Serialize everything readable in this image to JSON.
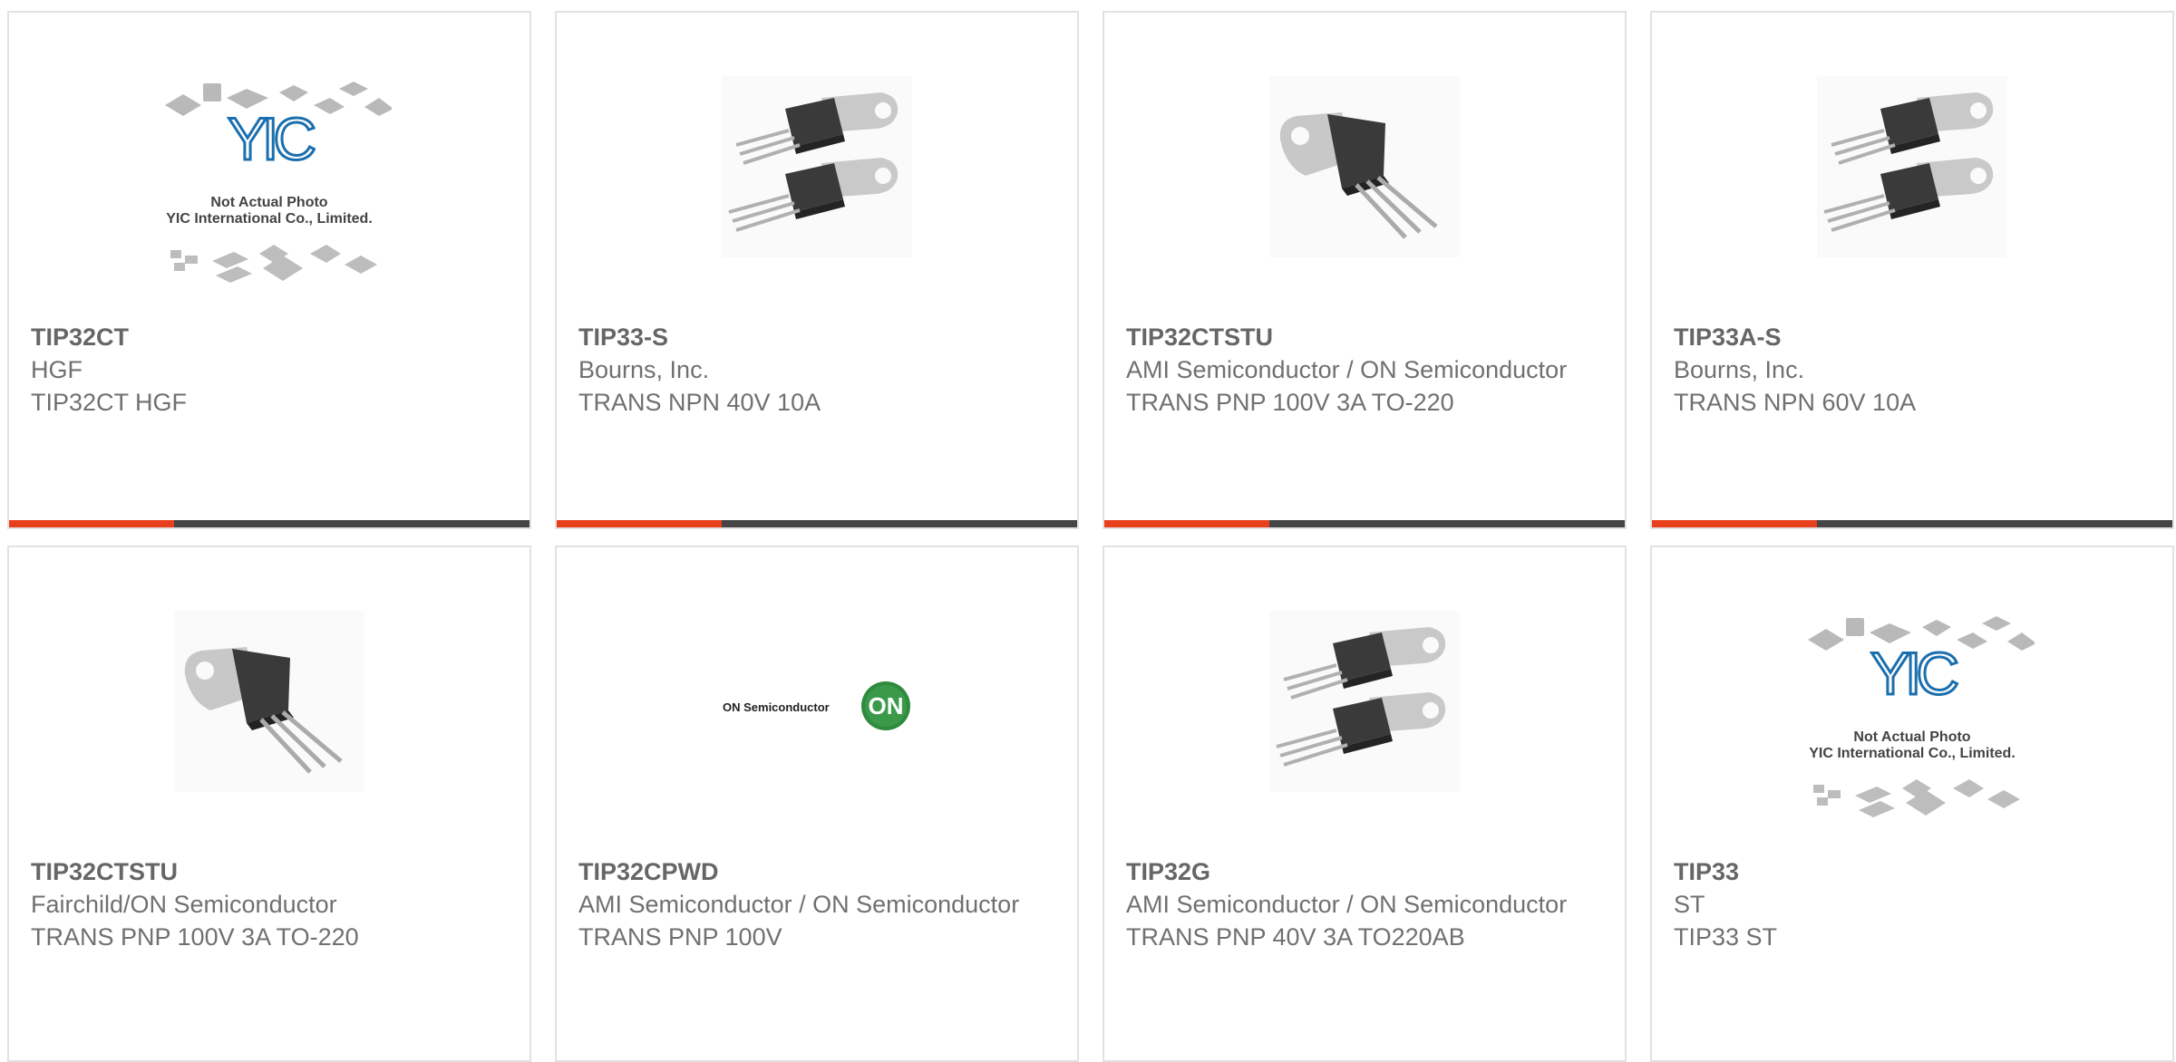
{
  "colors": {
    "accent": "#e8401c",
    "bar": "#454545",
    "border": "#e2e2e2",
    "text": "#707070"
  },
  "products": [
    {
      "part": "TIP32CT",
      "manufacturer": "HGF",
      "description": "TIP32CT HGF",
      "image": "not-actual-photo-placeholder",
      "placeholder_text": {
        "logo": "YIC",
        "line1": "Not Actual Photo",
        "line2": "YIC International Co., Limited."
      }
    },
    {
      "part": "TIP33-S",
      "manufacturer": "Bourns, Inc.",
      "description": "TRANS NPN 40V 10A",
      "image": "to220-pair"
    },
    {
      "part": "TIP32CTSTU",
      "manufacturer": "AMI Semiconductor / ON Semiconductor",
      "description": "TRANS PNP 100V 3A TO-220",
      "image": "to220-single"
    },
    {
      "part": "TIP33A-S",
      "manufacturer": "Bourns, Inc.",
      "description": "TRANS NPN 60V 10A",
      "image": "to220-pair"
    },
    {
      "part": "TIP32CTSTU",
      "manufacturer": "Fairchild/ON Semiconductor",
      "description": "TRANS PNP 100V 3A TO-220",
      "image": "to220-single"
    },
    {
      "part": "TIP32CPWD",
      "manufacturer": "AMI Semiconductor / ON Semiconductor",
      "description": "TRANS PNP 100V",
      "image": "on-semiconductor-logo",
      "logo_text": {
        "wordmark": "ON Semiconductor",
        "badge": "ON"
      }
    },
    {
      "part": "TIP32G",
      "manufacturer": "AMI Semiconductor / ON Semiconductor",
      "description": "TRANS PNP 40V 3A TO220AB",
      "image": "to220-pair"
    },
    {
      "part": "TIP33",
      "manufacturer": "ST",
      "description": "TIP33 ST",
      "image": "not-actual-photo-placeholder",
      "placeholder_text": {
        "logo": "YIC",
        "line1": "Not Actual Photo",
        "line2": "YIC International Co., Limited."
      }
    }
  ]
}
